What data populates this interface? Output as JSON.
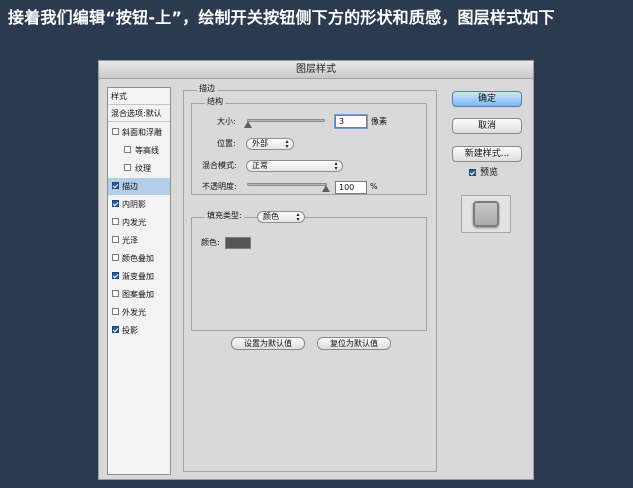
{
  "caption": "接着我们编辑“按钮-上”，绘制开关按钮侧下方的形状和质感，图层样式如下",
  "dialog": {
    "title": "图层样式",
    "styles_panel": {
      "header": "样式",
      "blending": "混合选项:默认",
      "items": [
        {
          "label": "斜面和浮雕",
          "checked": false
        },
        {
          "label": "等高线",
          "checked": false
        },
        {
          "label": "纹理",
          "checked": false
        },
        {
          "label": "描边",
          "checked": true
        },
        {
          "label": "内阴影",
          "checked": true
        },
        {
          "label": "内发光",
          "checked": false
        },
        {
          "label": "光泽",
          "checked": false
        },
        {
          "label": "颜色叠加",
          "checked": false
        },
        {
          "label": "渐变叠加",
          "checked": true
        },
        {
          "label": "图案叠加",
          "checked": false
        },
        {
          "label": "外发光",
          "checked": false
        },
        {
          "label": "投影",
          "checked": true
        }
      ]
    },
    "stroke": {
      "group_title": "描边",
      "structure_title": "结构",
      "size_label": "大小:",
      "size_value": "3",
      "size_unit": "像素",
      "position_label": "位置:",
      "position_value": "外部",
      "blend_label": "混合模式:",
      "blend_value": "正常",
      "opacity_label": "不透明度:",
      "opacity_value": "100",
      "opacity_unit": "%",
      "fill_type_label": "填充类型:",
      "fill_type_value": "颜色",
      "color_label": "颜色:",
      "color_hex": "#555555",
      "make_default": "设置为默认值",
      "reset_default": "复位为默认值"
    },
    "buttons": {
      "ok": "确定",
      "cancel": "取消",
      "new_style": "新建样式...",
      "preview_label": "预览",
      "preview_checked": true
    }
  }
}
